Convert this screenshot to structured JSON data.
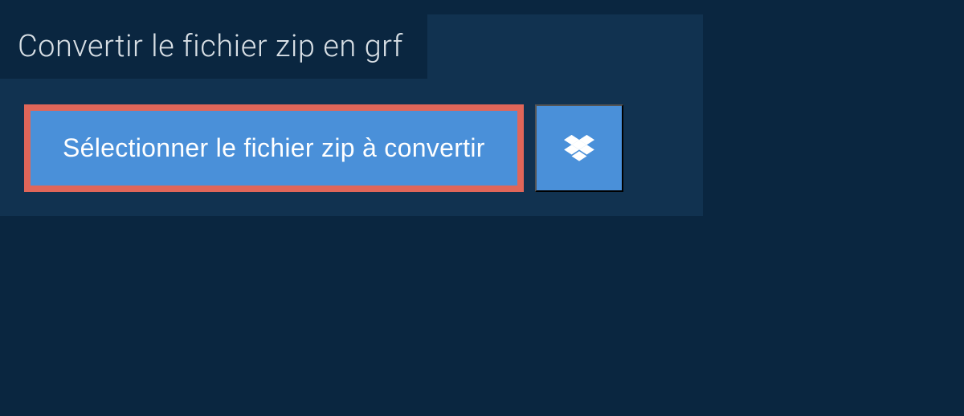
{
  "header": {
    "title": "Convertir le fichier zip en grf"
  },
  "buttons": {
    "select_label": "Sélectionner le fichier zip à convertir"
  },
  "colors": {
    "highlight_border": "#e06659",
    "button_bg": "#4a90d9",
    "panel_bg": "#113250",
    "page_bg": "#0a2640"
  }
}
